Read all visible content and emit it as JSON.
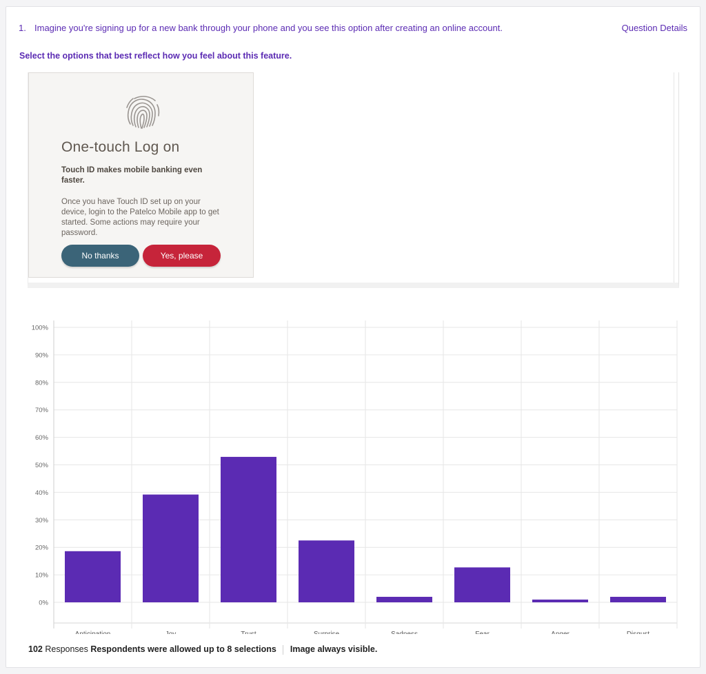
{
  "question": {
    "number": "1.",
    "text": "Imagine you're signing up for a new bank through your phone and you see this option after creating an online account.",
    "details_link": "Question Details",
    "instruction": "Select the options that best reflect how you feel about this feature."
  },
  "stimulus": {
    "icon": "fingerprint-icon",
    "title": "One-touch Log on",
    "subtitle": "Touch ID makes mobile banking even faster.",
    "body": "Once you have Touch ID set up on your device, login to the Patelco Mobile app to get started. Some actions may require your password.",
    "no_button": "No thanks",
    "yes_button": "Yes, please",
    "colors": {
      "no": "#3b6478",
      "yes": "#c6243a"
    }
  },
  "chart_data": {
    "type": "bar",
    "categories": [
      "Anticipation",
      "Joy",
      "Trust",
      "Surprise",
      "Sadness",
      "Fear",
      "Anger",
      "Disgust"
    ],
    "values": [
      18.6,
      39.2,
      52.9,
      22.5,
      2.0,
      12.7,
      1.0,
      2.0
    ],
    "ylim": [
      0,
      100
    ],
    "yticks": [
      "0%",
      "10%",
      "20%",
      "30%",
      "40%",
      "50%",
      "60%",
      "70%",
      "80%",
      "90%",
      "100%"
    ],
    "bar_color": "#5b2bb3",
    "grid": true
  },
  "footer": {
    "responses_count": "102",
    "responses_label": "Responses",
    "selection_note": "Respondents were allowed up to 8 selections",
    "visibility_note": "Image always visible."
  }
}
